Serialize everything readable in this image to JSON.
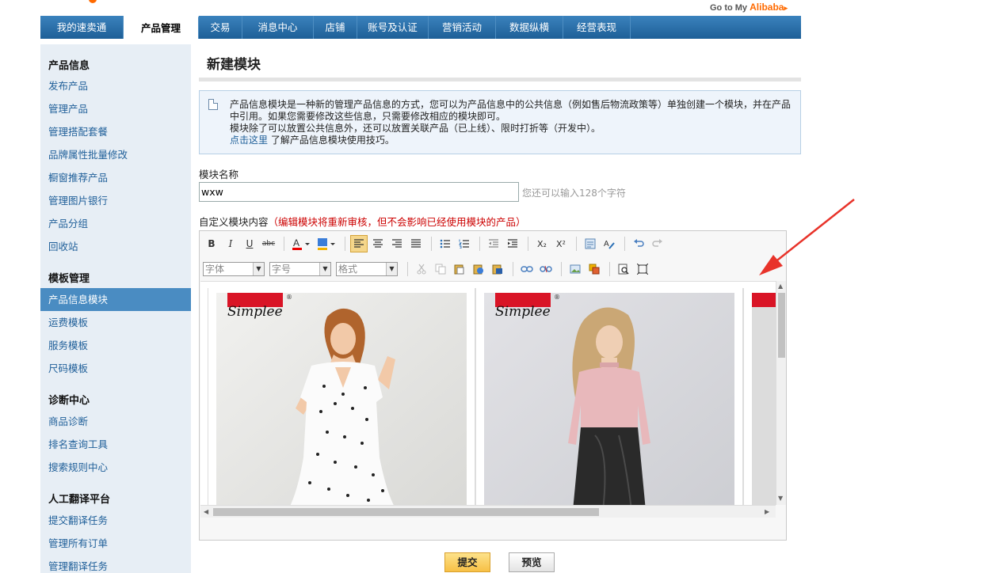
{
  "top": {
    "goto_prefix": "Go to My ",
    "goto_brand": "Alibaba",
    "goto_arrow": "▸"
  },
  "nav": [
    "我的速卖通",
    "产品管理",
    "交易",
    "消息中心",
    "店铺",
    "账号及认证",
    "营销活动",
    "数据纵横",
    "经营表现"
  ],
  "sidebar": {
    "groups": [
      {
        "title": "产品信息",
        "items": [
          "发布产品",
          "管理产品",
          "管理搭配套餐",
          "品牌属性批量修改",
          "橱窗推荐产品",
          "管理图片银行",
          "产品分组",
          "回收站"
        ]
      },
      {
        "title": "模板管理",
        "items": [
          "产品信息模块",
          "运费模板",
          "服务模板",
          "尺码模板"
        ]
      },
      {
        "title": "诊断中心",
        "items": [
          "商品诊断",
          "排名查询工具",
          "搜索规则中心"
        ]
      },
      {
        "title": "人工翻译平台",
        "items": [
          "提交翻译任务",
          "管理所有订单",
          "管理翻译任务"
        ]
      }
    ]
  },
  "page": {
    "title": "新建模块",
    "info_line1": "产品信息模块是一种新的管理产品信息的方式，您可以为产品信息中的公共信息（例如售后物流政策等）单独创建一个模块，并在产品中引用。如果您需要修改这些信息，只需要修改相应的模块即可。",
    "info_line2": "模块除了可以放置公共信息外，还可以放置关联产品（已上线）、限时打折等（开发中）。",
    "info_link": "点击这里",
    "info_link_suffix": " 了解产品信息模块使用技巧。",
    "name_label": "模块名称",
    "name_value": "wxw",
    "name_hint": "您还可以输入128个字符",
    "content_label": "自定义模块内容",
    "content_warning": "（编辑模块将重新审核，但不会影响已经使用模块的产品）",
    "submit": "提交",
    "preview": "预览"
  },
  "editor": {
    "font_placeholder": "字体",
    "size_placeholder": "字号",
    "format_placeholder": "格式",
    "bold": "B",
    "italic": "I",
    "underline": "U",
    "strike": "abc",
    "subscript": "X₂",
    "superscript": "X²",
    "brand_logo_text": "Simplee",
    "registered_mark": "®"
  },
  "annotation": {
    "arrow_color": "#e8332a"
  }
}
